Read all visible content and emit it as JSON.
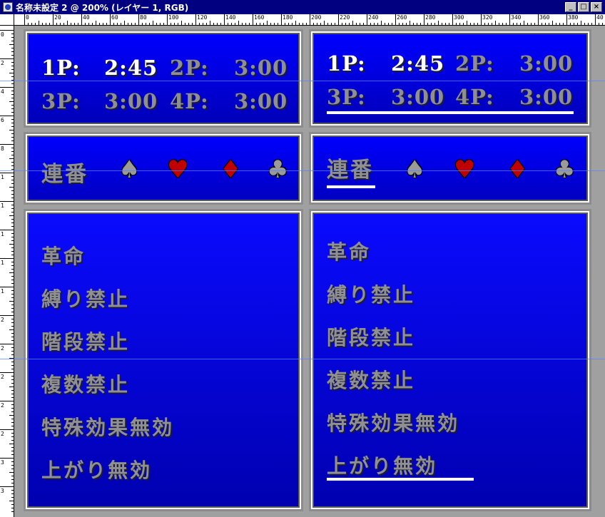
{
  "window": {
    "title": "名称未設定 2 @ 200% (レイヤー 1, RGB)",
    "buttons": [
      "_",
      "□",
      "×"
    ]
  },
  "ruler": {
    "h_labels": [
      "0",
      "20",
      "40",
      "60",
      "80",
      "100",
      "120",
      "140",
      "160",
      "180",
      "200",
      "220",
      "240",
      "260",
      "280",
      "300",
      "320",
      "340",
      "360",
      "380",
      "40"
    ],
    "v_labels": [
      "0",
      "2",
      "4",
      "6",
      "8",
      "1",
      "1",
      "1",
      "1",
      "1",
      "2",
      "2",
      "2",
      "2",
      "2",
      "3",
      "3"
    ]
  },
  "time_panels": [
    {
      "players": [
        {
          "label": "1P:",
          "time": "2:45",
          "style": "white"
        },
        {
          "label": "2P:",
          "time": "3:00",
          "style": "gray"
        },
        {
          "label": "3P:",
          "time": "3:00",
          "style": "gray"
        },
        {
          "label": "4P:",
          "time": "3:00",
          "style": "gray"
        }
      ]
    },
    {
      "players": [
        {
          "label": "1P:",
          "time": "2:45",
          "style": "white"
        },
        {
          "label": "2P:",
          "time": "3:00",
          "style": "gray"
        },
        {
          "label": "3P:",
          "time": "3:00",
          "style": "gray"
        },
        {
          "label": "4P:",
          "time": "3:00",
          "style": "gray"
        }
      ]
    }
  ],
  "sequence_panels": [
    {
      "label": "連番",
      "suits": [
        "♠",
        "♥",
        "♦",
        "♣"
      ]
    },
    {
      "label": "連番",
      "suits": [
        "♠",
        "♥",
        "♦",
        "♣"
      ]
    }
  ],
  "rule_panels": [
    {
      "items": [
        "革命",
        "縛り禁止",
        "階段禁止",
        "複数禁止",
        "特殊効果無効",
        "上がり無効"
      ]
    },
    {
      "items": [
        "革命",
        "縛り禁止",
        "階段禁止",
        "複数禁止",
        "特殊効果無効",
        "上がり無効"
      ]
    }
  ],
  "colors": {
    "panel_blue_top": "#0000ff",
    "panel_blue_bottom": "#0000b0",
    "text_white": "#ffffff",
    "text_gray": "#909090",
    "suit_red": "#c00000",
    "suit_gray": "#9a9a9a",
    "titlebar": "#000080"
  }
}
